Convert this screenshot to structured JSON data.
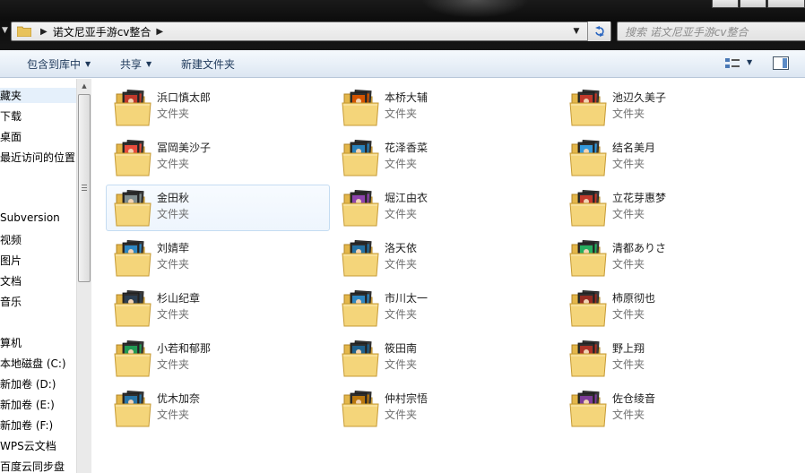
{
  "address": {
    "crumbs": [
      "诺文尼亚手游cv整合"
    ],
    "search_placeholder": "搜索 诺文尼亚手游cv整合"
  },
  "toolbar": {
    "organize_label": "包含到库中",
    "share_label": "共享",
    "new_folder_label": "新建文件夹"
  },
  "nav": {
    "items": [
      "藏夹",
      "下载",
      "桌面",
      "最近访问的位置",
      "Subversion",
      "视频",
      "图片",
      "文档",
      "音乐",
      "算机",
      "本地磁盘 (C:)",
      "新加卷 (D:)",
      "新加卷 (E:)",
      "新加卷 (F:)",
      "WPS云文档",
      "百度云同步盘"
    ]
  },
  "folder_type_label": "文件夹",
  "folders": [
    {
      "name": "浜口慎太郎",
      "accent": "#c0392b"
    },
    {
      "name": "本桥大辅",
      "accent": "#d35400"
    },
    {
      "name": "池辺久美子",
      "accent": "#c0392b"
    },
    {
      "name": "冨岡美沙子",
      "accent": "#e74c3c"
    },
    {
      "name": "花泽香菜",
      "accent": "#2980b9"
    },
    {
      "name": "结名美月",
      "accent": "#3498db"
    },
    {
      "name": "金田秋",
      "accent": "#7f8c8d"
    },
    {
      "name": "堀江由衣",
      "accent": "#8e44ad"
    },
    {
      "name": "立花芽惠梦",
      "accent": "#c0392b"
    },
    {
      "name": "刘婧荦",
      "accent": "#2e86c1"
    },
    {
      "name": "洛天依",
      "accent": "#2471a3"
    },
    {
      "name": "清都ありさ",
      "accent": "#27ae60"
    },
    {
      "name": "杉山纪章",
      "accent": "#2c3e50"
    },
    {
      "name": "市川太一",
      "accent": "#2e86c1"
    },
    {
      "name": "柿原彻也",
      "accent": "#922b21"
    },
    {
      "name": "小若和郁那",
      "accent": "#229954"
    },
    {
      "name": "筱田南",
      "accent": "#1f618d"
    },
    {
      "name": "野上翔",
      "accent": "#a93226"
    },
    {
      "name": "优木加奈",
      "accent": "#2874a6"
    },
    {
      "name": "仲村宗悟",
      "accent": "#b9770e"
    },
    {
      "name": "佐仓绫音",
      "accent": "#7d3c98"
    }
  ]
}
